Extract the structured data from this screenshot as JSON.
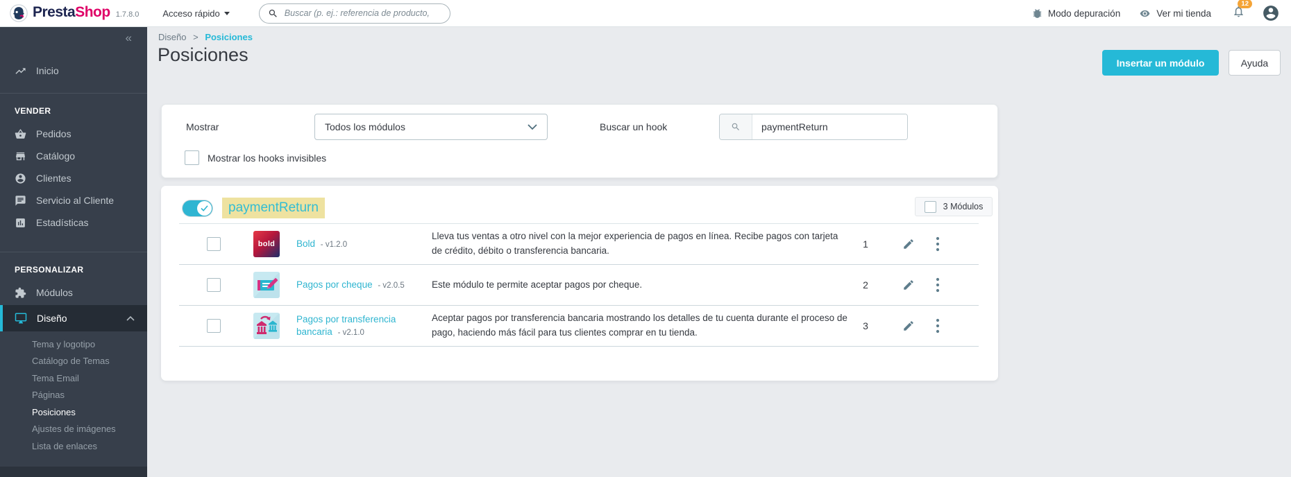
{
  "colors": {
    "accent_teal": "#25b9d7",
    "brand_pink": "#df0067",
    "brand_navy": "#1d2550",
    "highlight_yellow": "#eee2a0",
    "badge_orange": "#f4a437",
    "sidebar_dark": "#373f4b"
  },
  "topbar": {
    "brand_presta": "Presta",
    "brand_shop": "Shop",
    "version": "1.7.8.0",
    "quick_access": "Acceso rápido",
    "search_placeholder": "Buscar (p. ej.: referencia de producto,",
    "debug_mode": "Modo depuración",
    "view_shop": "Ver mi tienda",
    "notification_count": "12"
  },
  "sidebar": {
    "collapse": "«",
    "home": "Inicio",
    "sections": {
      "vender": {
        "label": "VENDER",
        "items": [
          "Pedidos",
          "Catálogo",
          "Clientes",
          "Servicio al Cliente",
          "Estadísticas"
        ]
      },
      "personalizar": {
        "label": "PERSONALIZAR",
        "modules": "Módulos",
        "design": "Diseño"
      }
    },
    "design_submenu": [
      "Tema y logotipo",
      "Catálogo de Temas",
      "Tema Email",
      "Páginas",
      "Posiciones",
      "Ajustes de imágenes",
      "Lista de enlaces"
    ],
    "active_submenu": "Posiciones"
  },
  "page": {
    "breadcrumb_parent": "Diseño",
    "breadcrumb_sep": ">",
    "breadcrumb_current": "Posiciones",
    "title": "Posiciones",
    "insert_module_button": "Insertar un módulo",
    "help_button": "Ayuda"
  },
  "filters": {
    "show_label": "Mostrar",
    "modules_select_value": "Todos los módulos",
    "search_hook_label": "Buscar un hook",
    "search_hook_value": "paymentReturn",
    "show_invisible_hooks_label": "Mostrar los hooks invisibles"
  },
  "hook": {
    "name": "paymentReturn",
    "modules_count": "3 Módulos",
    "modules": [
      {
        "icon": "bold",
        "icon_label": "bold",
        "name": "Bold",
        "version": "- v1.2.0",
        "description": "Lleva tus ventas a otro nivel con la mejor experiencia de pagos en línea. Recibe pagos con tarjeta de crédito, débito o transferencia bancaria.",
        "position": "1"
      },
      {
        "icon": "cheque",
        "name": "Pagos por cheque",
        "version": "- v2.0.5",
        "description": "Este módulo te permite aceptar pagos por cheque.",
        "position": "2"
      },
      {
        "icon": "wire",
        "name": "Pagos por transferencia bancaria",
        "version": "- v2.1.0",
        "description": "Aceptar pagos por transferencia bancaria mostrando los detalles de tu cuenta durante el proceso de pago, haciendo más fácil para tus clientes comprar en tu tienda.",
        "position": "3"
      }
    ]
  }
}
